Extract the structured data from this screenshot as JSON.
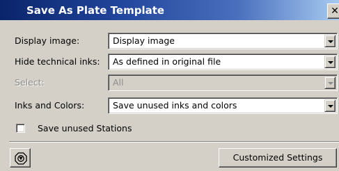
{
  "dialog": {
    "title": "Save As Plate Template",
    "close_glyph": "✕"
  },
  "fields": [
    {
      "label": "Display image:",
      "value": "Display image",
      "enabled": true
    },
    {
      "label": "Hide technical inks:",
      "value": "As defined in original file",
      "enabled": true
    },
    {
      "label": "Select:",
      "value": "All",
      "enabled": false
    },
    {
      "label": "Inks and Colors:",
      "value": "Save unused inks and colors",
      "enabled": true
    }
  ],
  "save_unused_stations": {
    "label": "Save unused Stations",
    "checked": false
  },
  "footer": {
    "icon_button": "stop-sign-icon",
    "customized_settings_label": "Customized Settings"
  },
  "colors": {
    "title_gradient_start": "#0a246a",
    "title_gradient_end": "#a6caf0",
    "dialog_background": "#d4d0c8",
    "disabled_text": "#8c8c8c"
  }
}
